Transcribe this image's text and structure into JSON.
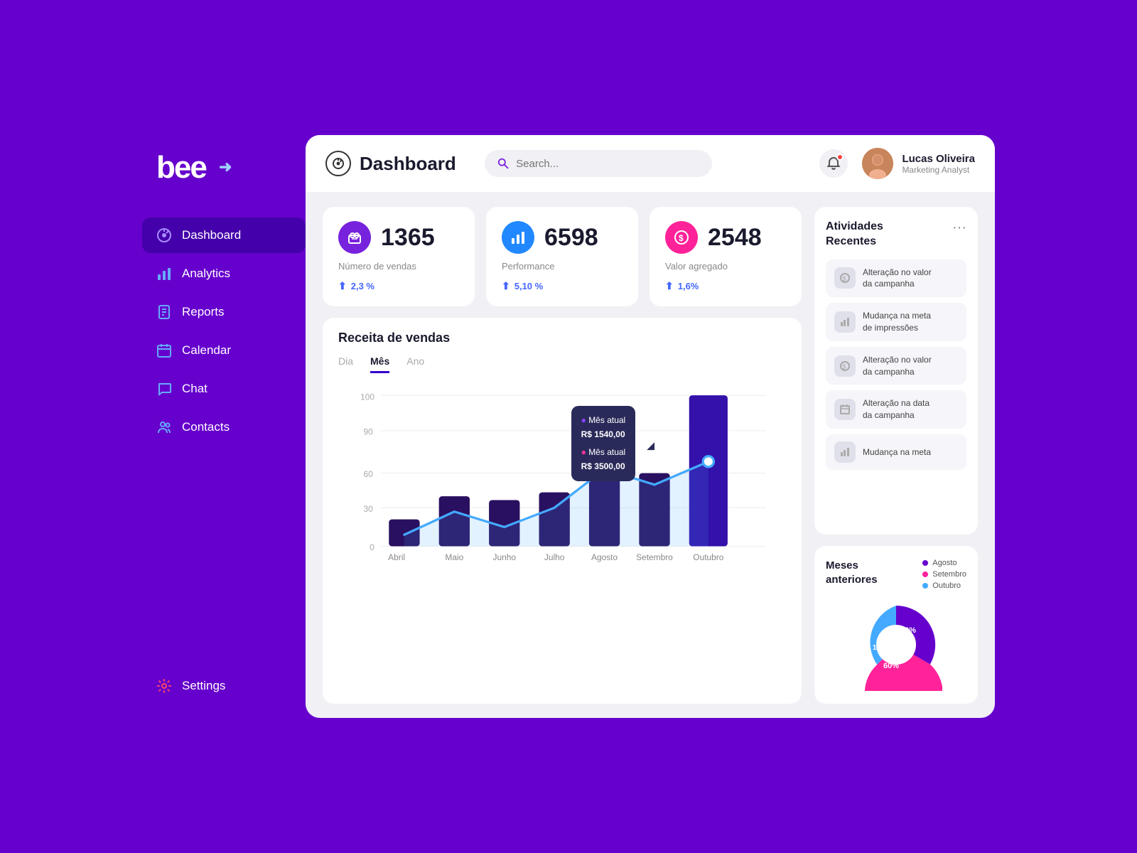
{
  "sidebar": {
    "logo": "bee",
    "nav_items": [
      {
        "id": "dashboard",
        "label": "Dashboard",
        "icon": "⊙",
        "active": true
      },
      {
        "id": "analytics",
        "label": "Analytics",
        "icon": "📊",
        "active": false
      },
      {
        "id": "reports",
        "label": "Reports",
        "icon": "📋",
        "active": false
      },
      {
        "id": "calendar",
        "label": "Calendar",
        "icon": "📅",
        "active": false
      },
      {
        "id": "chat",
        "label": "Chat",
        "icon": "💬",
        "active": false
      },
      {
        "id": "contacts",
        "label": "Contacts",
        "icon": "👥",
        "active": false
      }
    ],
    "settings_label": "Settings"
  },
  "header": {
    "title": "Dashboard",
    "search_placeholder": "Search...",
    "user": {
      "name": "Lucas Oliveira",
      "role": "Marketing Analyst"
    }
  },
  "stats": [
    {
      "value": "1365",
      "label": "Número de vendas",
      "change": "2,3 %",
      "icon": "🛒",
      "icon_class": "purple"
    },
    {
      "value": "6598",
      "label": "Performance",
      "change": "5,10 %",
      "icon": "📈",
      "icon_class": "blue"
    },
    {
      "value": "2548",
      "label": "Valor agregado",
      "change": "1,6%",
      "icon": "💰",
      "icon_class": "pink"
    }
  ],
  "chart": {
    "title": "Receita de vendas",
    "tabs": [
      "Dia",
      "Mês",
      "Ano"
    ],
    "active_tab": "Mês",
    "months": [
      "Abril",
      "Maio",
      "Junho",
      "Julho",
      "Agosto",
      "Setembro",
      "Outubro"
    ],
    "tooltip": {
      "line1_label": "Mês atual",
      "line1_value": "R$ 1540,00",
      "line2_label": "Mês atual",
      "line2_value": "R$ 3500,00"
    }
  },
  "activities": {
    "title": "Atividades\nRecentes",
    "items": [
      {
        "icon": "💰",
        "text": "Alteração no valor\nda campanha"
      },
      {
        "icon": "📊",
        "text": "Mudança na meta\nde impressões"
      },
      {
        "icon": "💰",
        "text": "Alteração no valor\nda campanha"
      },
      {
        "icon": "📅",
        "text": "Alteração na data\nda campanha"
      },
      {
        "icon": "📊",
        "text": "Mudança na meta"
      }
    ]
  },
  "meses": {
    "title": "Meses\nanteriores",
    "legend": [
      {
        "label": "Agosto",
        "color": "#6600cc"
      },
      {
        "label": "Setembro",
        "color": "#ff2299"
      },
      {
        "label": "Outubro",
        "color": "#44aaff"
      }
    ],
    "segments": [
      {
        "percent": 30,
        "color": "#6600cc",
        "label": "30%"
      },
      {
        "percent": 60,
        "color": "#ff2299",
        "label": "60%"
      },
      {
        "percent": 10,
        "color": "#44aaff",
        "label": "10%"
      }
    ]
  }
}
